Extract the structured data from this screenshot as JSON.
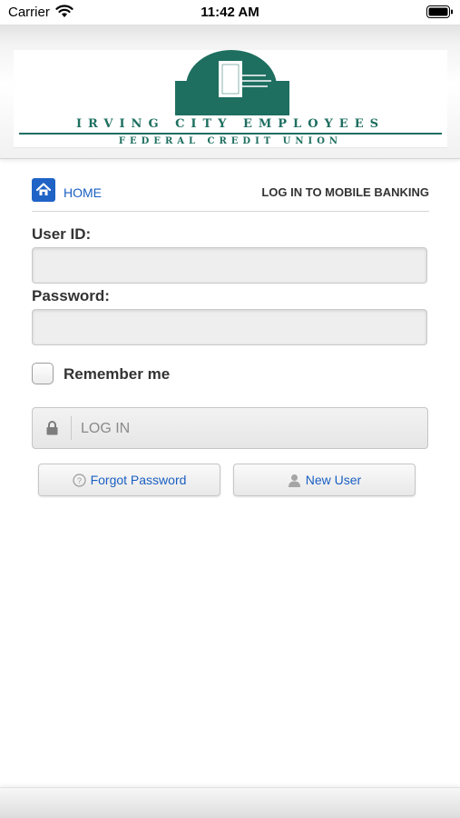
{
  "status_bar": {
    "carrier": "Carrier",
    "time": "11:42 AM"
  },
  "logo": {
    "line1": "IRVING CITY EMPLOYEES",
    "line2": "FEDERAL CREDIT UNION",
    "color": "#1e6f60"
  },
  "breadcrumb": {
    "home_label": "HOME",
    "heading": "LOG IN TO MOBILE BANKING"
  },
  "form": {
    "user_id_label": "User ID:",
    "user_id_value": "",
    "password_label": "Password:",
    "password_value": "",
    "remember_label": "Remember me",
    "remember_checked": false,
    "login_label": "LOG IN"
  },
  "actions": {
    "forgot_label": "Forgot Password",
    "new_user_label": "New User"
  },
  "colors": {
    "link": "#1a5fc2",
    "home_button": "#1f63c7",
    "text": "#333333"
  },
  "icons": [
    "wifi-icon",
    "battery-icon",
    "home-icon",
    "lock-icon",
    "help-icon",
    "user-icon"
  ]
}
